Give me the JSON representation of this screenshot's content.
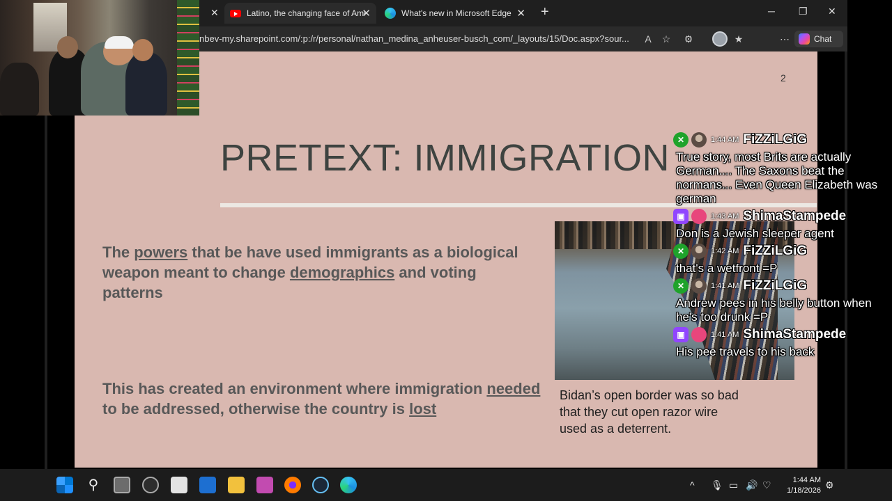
{
  "browser": {
    "tabs": [
      {
        "title": "Latino, the changing face of Ameri",
        "icon": "youtube-icon",
        "close": "✕"
      },
      {
        "title": "What's new in Microsoft Edge",
        "icon": "edge-icon",
        "close": "✕"
      }
    ],
    "first_close": "✕",
    "new_tab": "+",
    "window": {
      "minimize": "─",
      "maximize": "❐",
      "close": "✕"
    },
    "url": "nbev-my.sharepoint.com/:p:/r/personal/nathan_medina_anheuser-busch_com/_layouts/15/Doc.aspx?sour...",
    "read_aloud": "A",
    "chat_label": "Chat"
  },
  "slide": {
    "page_number": "2",
    "title": "PRETEXT: IMMIGRATION",
    "para1": {
      "t1": "The ",
      "u1": "powers",
      "t2": " that be have used immigrants as a biological weapon meant to change ",
      "u2": "demographics",
      "t3": " and voting patterns"
    },
    "para2": {
      "t1": "This has created an environment where immigration ",
      "u1": "needed",
      "t2": " to be addressed, otherwise the country is ",
      "u2": "lost"
    },
    "caption": "Bidan’s open border was so bad that they cut open razor wire used as a deterrent."
  },
  "chat": [
    {
      "platform": "xbox",
      "time": "1:44 AM",
      "user": "FiZZiLGiG",
      "text": "True story, most Brits are actually German.... The Saxons beat the normans... Even Queen Elizabeth was german"
    },
    {
      "platform": "twitch",
      "time": "1:43 AM",
      "user": "ShimaStampede",
      "text": "Don is a Jewish sleeper agent"
    },
    {
      "platform": "xbox",
      "time": "1:42 AM",
      "user": "FiZZiLGiG",
      "text": "that's a wetfront =P"
    },
    {
      "platform": "xbox",
      "time": "1:41 AM",
      "user": "FiZZiLGiG",
      "text": "Andrew pees in his belly button when he's too drunk =P"
    },
    {
      "platform": "twitch",
      "time": "1:41 AM",
      "user": "ShimaStampede",
      "text": "His pee travels to his back"
    }
  ],
  "taskbar": {
    "time": "1:44 AM",
    "date": "1/18/2026",
    "tray_chevron": "^",
    "colors": {
      "accent": "#0078d4",
      "edge": "#1b8ee0",
      "steam": "#1b2838"
    }
  }
}
